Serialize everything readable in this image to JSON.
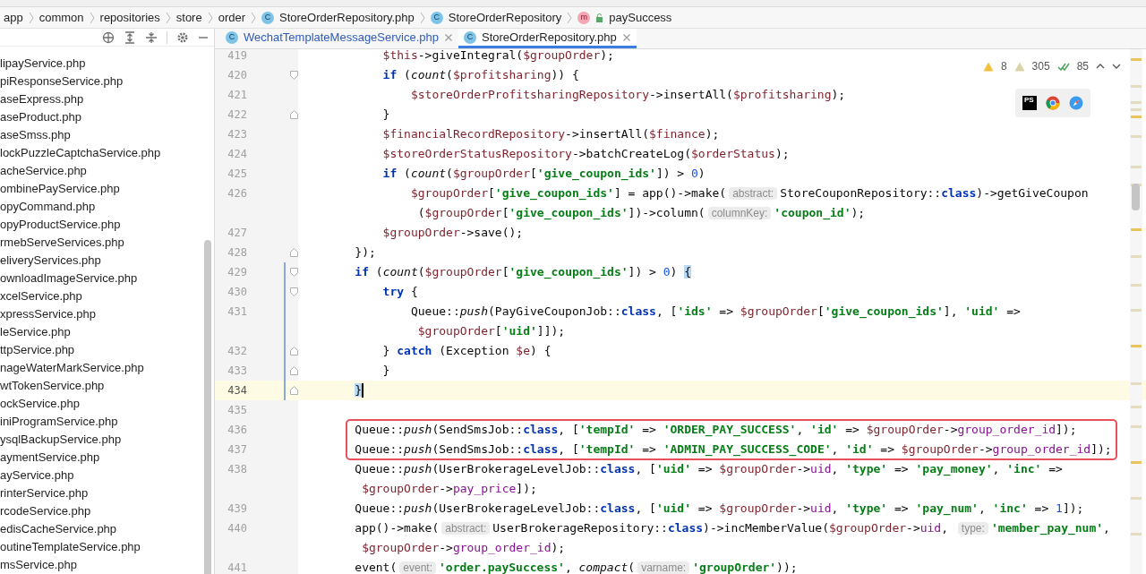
{
  "breadcrumbs": [
    {
      "label": "app",
      "kind": "folder"
    },
    {
      "label": "common",
      "kind": "folder"
    },
    {
      "label": "repositories",
      "kind": "folder"
    },
    {
      "label": "store",
      "kind": "folder"
    },
    {
      "label": "order",
      "kind": "folder"
    },
    {
      "label": "StoreOrderRepository.php",
      "kind": "class",
      "badge": "C"
    },
    {
      "label": "StoreOrderRepository",
      "kind": "class",
      "badge": "C"
    },
    {
      "label": "paySuccess",
      "kind": "method",
      "badge": "m"
    }
  ],
  "project_files": [
    "lipayService.php",
    "piResponseService.php",
    "aseExpress.php",
    "aseProduct.php",
    "aseSmss.php",
    "lockPuzzleCaptchaService.php",
    "acheService.php",
    "ombinePayService.php",
    "opyCommand.php",
    "opyProductService.php",
    "rmebServeServices.php",
    "eliveryServices.php",
    "ownloadImageService.php",
    "xcelService.php",
    "xpressService.php",
    "leService.php",
    "ttpService.php",
    "nageWaterMarkService.php",
    "wtTokenService.php",
    "ockService.php",
    "iniProgramService.php",
    "ysqlBackupService.php",
    "aymentService.php",
    "ayService.php",
    "rinterService.php",
    "rcodeService.php",
    "edisCacheService.php",
    "outineTemplateService.php",
    "msService.php"
  ],
  "tabs": [
    {
      "label": "WechatTemplateMessageService.php",
      "badge": "C",
      "selected": false
    },
    {
      "label": "StoreOrderRepository.php",
      "badge": "C",
      "selected": true
    }
  ],
  "inspections": {
    "warnings": "8",
    "weak_warnings": "305",
    "typos": "85"
  },
  "browsers": [
    {
      "kind": "phpstorm",
      "label": "PS"
    },
    {
      "kind": "chrome"
    },
    {
      "kind": "safari"
    }
  ],
  "lines": [
    {
      "number": "419",
      "tokens": [
        {
          "kind": "var",
          "text": "        $this"
        },
        {
          "kind": "plain",
          "text": "->giveIntegral("
        },
        {
          "kind": "var",
          "text": "$groupOrder"
        },
        {
          "kind": "plain",
          "text": ");"
        }
      ]
    },
    {
      "number": "420",
      "fold_start": true,
      "tokens": [
        {
          "kind": "keyword",
          "text": "        if"
        },
        {
          "kind": "plain",
          "text": " ("
        },
        {
          "kind": "italic",
          "text": "count"
        },
        {
          "kind": "plain",
          "text": "("
        },
        {
          "kind": "var",
          "text": "$profitsharing"
        },
        {
          "kind": "plain",
          "text": ")) {"
        }
      ]
    },
    {
      "number": "421",
      "tokens": [
        {
          "kind": "var",
          "text": "            $storeOrderProfitsharingRepository"
        },
        {
          "kind": "plain",
          "text": "->insertAll("
        },
        {
          "kind": "var",
          "text": "$profitsharing"
        },
        {
          "kind": "plain",
          "text": ");"
        }
      ]
    },
    {
      "number": "422",
      "fold_end": true,
      "tokens": [
        {
          "kind": "plain",
          "text": "        }"
        }
      ]
    },
    {
      "number": "423",
      "tokens": [
        {
          "kind": "var",
          "text": "        $financialRecordRepository"
        },
        {
          "kind": "plain",
          "text": "->insertAll("
        },
        {
          "kind": "var",
          "text": "$finance"
        },
        {
          "kind": "plain",
          "text": ");"
        }
      ]
    },
    {
      "number": "424",
      "tokens": [
        {
          "kind": "var",
          "text": "        $storeOrderStatusRepository"
        },
        {
          "kind": "plain",
          "text": "->batchCreateLog("
        },
        {
          "kind": "var",
          "text": "$orderStatus"
        },
        {
          "kind": "plain",
          "text": ");"
        }
      ]
    },
    {
      "number": "425",
      "tokens": [
        {
          "kind": "keyword",
          "text": "        if"
        },
        {
          "kind": "plain",
          "text": " ("
        },
        {
          "kind": "italic",
          "text": "count"
        },
        {
          "kind": "plain",
          "text": "("
        },
        {
          "kind": "var",
          "text": "$groupOrder"
        },
        {
          "kind": "plain",
          "text": "["
        },
        {
          "kind": "string",
          "text": "'give_coupon_ids'"
        },
        {
          "kind": "plain",
          "text": "]) > "
        },
        {
          "kind": "number",
          "text": "0"
        },
        {
          "kind": "plain",
          "text": ")"
        }
      ]
    },
    {
      "number": "426",
      "tokens": [
        {
          "kind": "var",
          "text": "            $groupOrder"
        },
        {
          "kind": "plain",
          "text": "["
        },
        {
          "kind": "string",
          "text": "'give_coupon_ids'"
        },
        {
          "kind": "plain",
          "text": "] = app()->make("
        },
        {
          "kind": "hint",
          "text": "abstract:"
        },
        {
          "kind": "plain",
          "text": "StoreCouponRepository::"
        },
        {
          "kind": "keyword",
          "text": "class"
        },
        {
          "kind": "plain",
          "text": ")->getGiveCoupon"
        }
      ]
    },
    {
      "tokens": [
        {
          "kind": "plain",
          "text": "             ("
        },
        {
          "kind": "var",
          "text": "$groupOrder"
        },
        {
          "kind": "plain",
          "text": "["
        },
        {
          "kind": "string",
          "text": "'give_coupon_ids'"
        },
        {
          "kind": "plain",
          "text": "])->column("
        },
        {
          "kind": "hint",
          "text": "columnKey:"
        },
        {
          "kind": "string",
          "text": "'coupon_id'"
        },
        {
          "kind": "plain",
          "text": ");"
        }
      ]
    },
    {
      "number": "427",
      "tokens": [
        {
          "kind": "var",
          "text": "        $groupOrder"
        },
        {
          "kind": "plain",
          "text": "->save();"
        }
      ]
    },
    {
      "number": "428",
      "fold_end": true,
      "tokens": [
        {
          "kind": "plain",
          "text": "    });"
        }
      ]
    },
    {
      "number": "429",
      "fold_start": true,
      "changed": true,
      "tokens": [
        {
          "kind": "keyword",
          "text": "    if"
        },
        {
          "kind": "plain",
          "text": " ("
        },
        {
          "kind": "italic",
          "text": "count"
        },
        {
          "kind": "plain",
          "text": "("
        },
        {
          "kind": "var",
          "text": "$groupOrder"
        },
        {
          "kind": "plain",
          "text": "["
        },
        {
          "kind": "string",
          "text": "'give_coupon_ids'"
        },
        {
          "kind": "plain",
          "text": "]) > "
        },
        {
          "kind": "number",
          "text": "0"
        },
        {
          "kind": "plain",
          "text": ") "
        },
        {
          "kind": "brace",
          "text": "{"
        }
      ]
    },
    {
      "number": "430",
      "fold_start": true,
      "changed": true,
      "tokens": [
        {
          "kind": "keyword",
          "text": "        try"
        },
        {
          "kind": "plain",
          "text": " {"
        }
      ]
    },
    {
      "number": "431",
      "changed": true,
      "tokens": [
        {
          "kind": "plain",
          "text": "            Queue::"
        },
        {
          "kind": "italic",
          "text": "push"
        },
        {
          "kind": "plain",
          "text": "(PayGiveCouponJob::"
        },
        {
          "kind": "keyword",
          "text": "class"
        },
        {
          "kind": "plain",
          "text": ", ["
        },
        {
          "kind": "string",
          "text": "'ids'"
        },
        {
          "kind": "plain",
          "text": " => "
        },
        {
          "kind": "var",
          "text": "$groupOrder"
        },
        {
          "kind": "plain",
          "text": "["
        },
        {
          "kind": "string",
          "text": "'give_coupon_ids'"
        },
        {
          "kind": "plain",
          "text": "], "
        },
        {
          "kind": "string",
          "text": "'uid'"
        },
        {
          "kind": "plain",
          "text": " =>"
        }
      ]
    },
    {
      "changed": true,
      "tokens": [
        {
          "kind": "var",
          "text": "             $groupOrder"
        },
        {
          "kind": "plain",
          "text": "["
        },
        {
          "kind": "string",
          "text": "'uid'"
        },
        {
          "kind": "plain",
          "text": "]]);"
        }
      ]
    },
    {
      "number": "432",
      "fold_end": true,
      "changed": true,
      "tokens": [
        {
          "kind": "plain",
          "text": "        } "
        },
        {
          "kind": "keyword",
          "text": "catch"
        },
        {
          "kind": "plain",
          "text": " (Exception "
        },
        {
          "kind": "var",
          "text": "$e"
        },
        {
          "kind": "plain",
          "text": ") {"
        }
      ]
    },
    {
      "number": "433",
      "fold_end": true,
      "changed": true,
      "tokens": [
        {
          "kind": "plain",
          "text": "        }"
        }
      ]
    },
    {
      "number": "434",
      "fold_end": true,
      "changed": true,
      "current": true,
      "tokens": [
        {
          "kind": "brace",
          "text": "    }"
        }
      ]
    },
    {
      "number": "435"
    },
    {
      "number": "436",
      "boxed": true,
      "tokens": [
        {
          "kind": "plain",
          "text": "    Queue::"
        },
        {
          "kind": "italic",
          "text": "push"
        },
        {
          "kind": "plain",
          "text": "(SendSmsJob::"
        },
        {
          "kind": "keyword",
          "text": "class"
        },
        {
          "kind": "plain",
          "text": ", ["
        },
        {
          "kind": "string",
          "text": "'tempId'"
        },
        {
          "kind": "plain",
          "text": " => "
        },
        {
          "kind": "string",
          "text": "'ORDER_PAY_SUCCESS'"
        },
        {
          "kind": "plain",
          "text": ", "
        },
        {
          "kind": "string",
          "text": "'id'"
        },
        {
          "kind": "plain",
          "text": " => "
        },
        {
          "kind": "var",
          "text": "$groupOrder"
        },
        {
          "kind": "plain",
          "text": "->"
        },
        {
          "kind": "prop",
          "text": "group_order_id"
        },
        {
          "kind": "plain",
          "text": "]);"
        }
      ]
    },
    {
      "number": "437",
      "boxed": true,
      "tokens": [
        {
          "kind": "plain",
          "text": "    Queue::"
        },
        {
          "kind": "italic",
          "text": "push"
        },
        {
          "kind": "plain",
          "text": "(SendSmsJob::"
        },
        {
          "kind": "keyword",
          "text": "class"
        },
        {
          "kind": "plain",
          "text": ", ["
        },
        {
          "kind": "string",
          "text": "'tempId'"
        },
        {
          "kind": "plain",
          "text": " => "
        },
        {
          "kind": "string",
          "text": "'ADMIN_PAY_SUCCESS_CODE'"
        },
        {
          "kind": "plain",
          "text": ", "
        },
        {
          "kind": "string",
          "text": "'id'"
        },
        {
          "kind": "plain",
          "text": " => "
        },
        {
          "kind": "var",
          "text": "$groupOrder"
        },
        {
          "kind": "plain",
          "text": "->"
        },
        {
          "kind": "prop",
          "text": "group_order_id"
        },
        {
          "kind": "plain",
          "text": "]);"
        }
      ]
    },
    {
      "number": "438",
      "tokens": [
        {
          "kind": "plain",
          "text": "    Queue::"
        },
        {
          "kind": "italic",
          "text": "push"
        },
        {
          "kind": "plain",
          "text": "(UserBrokerageLevelJob::"
        },
        {
          "kind": "keyword",
          "text": "class"
        },
        {
          "kind": "plain",
          "text": ", ["
        },
        {
          "kind": "string",
          "text": "'uid'"
        },
        {
          "kind": "plain",
          "text": " => "
        },
        {
          "kind": "var",
          "text": "$groupOrder"
        },
        {
          "kind": "plain",
          "text": "->"
        },
        {
          "kind": "prop",
          "text": "uid"
        },
        {
          "kind": "plain",
          "text": ", "
        },
        {
          "kind": "string",
          "text": "'type'"
        },
        {
          "kind": "plain",
          "text": " => "
        },
        {
          "kind": "string",
          "text": "'pay_money'"
        },
        {
          "kind": "plain",
          "text": ", "
        },
        {
          "kind": "string",
          "text": "'inc'"
        },
        {
          "kind": "plain",
          "text": " =>"
        }
      ]
    },
    {
      "tokens": [
        {
          "kind": "var",
          "text": "     $groupOrder"
        },
        {
          "kind": "plain",
          "text": "->"
        },
        {
          "kind": "prop",
          "text": "pay_price"
        },
        {
          "kind": "plain",
          "text": "]);"
        }
      ]
    },
    {
      "number": "439",
      "tokens": [
        {
          "kind": "plain",
          "text": "    Queue::"
        },
        {
          "kind": "italic",
          "text": "push"
        },
        {
          "kind": "plain",
          "text": "(UserBrokerageLevelJob::"
        },
        {
          "kind": "keyword",
          "text": "class"
        },
        {
          "kind": "plain",
          "text": ", ["
        },
        {
          "kind": "string",
          "text": "'uid'"
        },
        {
          "kind": "plain",
          "text": " => "
        },
        {
          "kind": "var",
          "text": "$groupOrder"
        },
        {
          "kind": "plain",
          "text": "->"
        },
        {
          "kind": "prop",
          "text": "uid"
        },
        {
          "kind": "plain",
          "text": ", "
        },
        {
          "kind": "string",
          "text": "'type'"
        },
        {
          "kind": "plain",
          "text": " => "
        },
        {
          "kind": "string",
          "text": "'pay_num'"
        },
        {
          "kind": "plain",
          "text": ", "
        },
        {
          "kind": "string",
          "text": "'inc'"
        },
        {
          "kind": "plain",
          "text": " => "
        },
        {
          "kind": "number",
          "text": "1"
        },
        {
          "kind": "plain",
          "text": "]);"
        }
      ]
    },
    {
      "number": "440",
      "tokens": [
        {
          "kind": "plain",
          "text": "    app()->make("
        },
        {
          "kind": "hint",
          "text": "abstract:"
        },
        {
          "kind": "plain",
          "text": "UserBrokerageRepository::"
        },
        {
          "kind": "keyword",
          "text": "class"
        },
        {
          "kind": "plain",
          "text": ")->incMemberValue("
        },
        {
          "kind": "var",
          "text": "$groupOrder"
        },
        {
          "kind": "plain",
          "text": "->"
        },
        {
          "kind": "prop",
          "text": "uid"
        },
        {
          "kind": "plain",
          "text": ", "
        },
        {
          "kind": "hint",
          "text": "type:"
        },
        {
          "kind": "string",
          "text": "'member_pay_num'"
        },
        {
          "kind": "plain",
          "text": ","
        }
      ]
    },
    {
      "tokens": [
        {
          "kind": "var",
          "text": "     $groupOrder"
        },
        {
          "kind": "plain",
          "text": "->"
        },
        {
          "kind": "prop",
          "text": "group_order_id"
        },
        {
          "kind": "plain",
          "text": ");"
        }
      ]
    },
    {
      "number": "441",
      "tokens": [
        {
          "kind": "plain",
          "text": "    event("
        },
        {
          "kind": "hint",
          "text": "event:"
        },
        {
          "kind": "string",
          "text": "'order.paySuccess'"
        },
        {
          "kind": "plain",
          "text": ", "
        },
        {
          "kind": "italic",
          "text": "compact"
        },
        {
          "kind": "plain",
          "text": "("
        },
        {
          "kind": "hint",
          "text": "varname:"
        },
        {
          "kind": "string",
          "text": "'groupOrder'"
        },
        {
          "kind": "plain",
          "text": "));"
        }
      ]
    }
  ]
}
